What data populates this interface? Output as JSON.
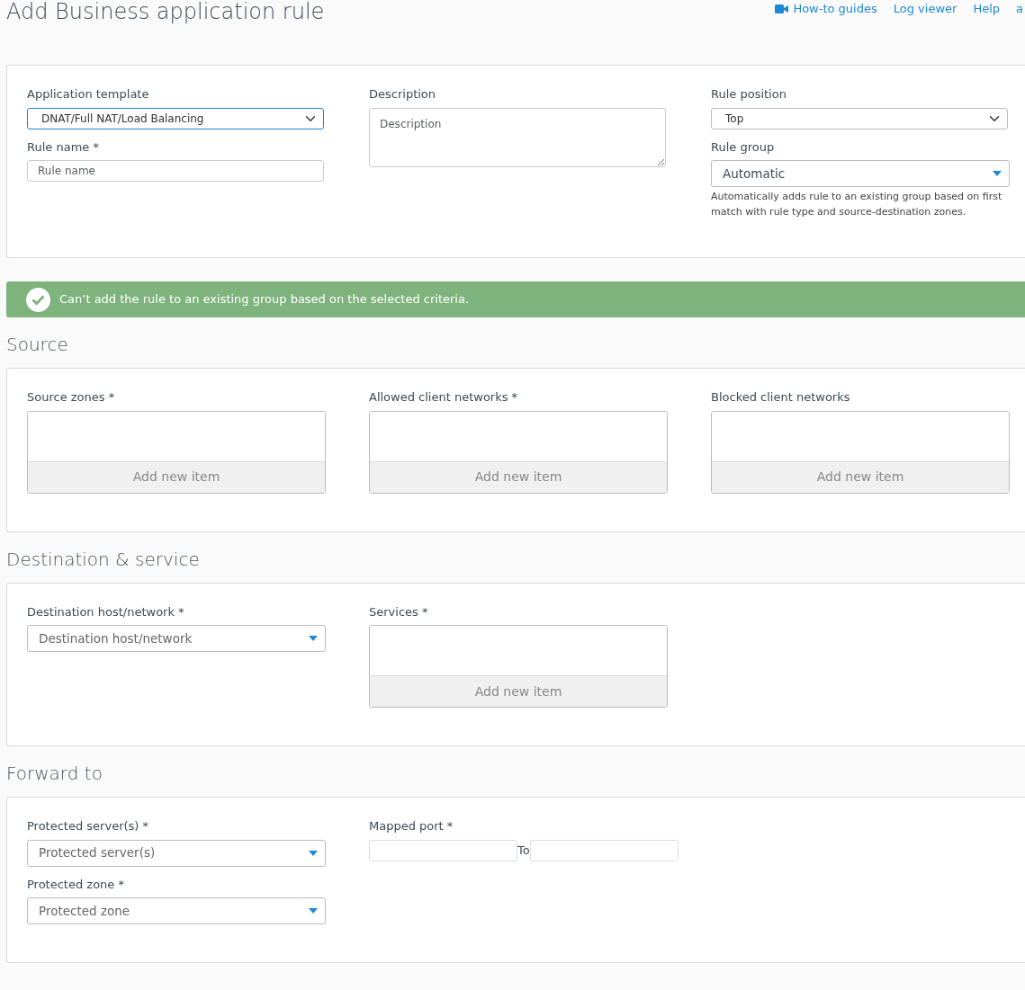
{
  "header": {
    "title": "Add Business application rule",
    "links": [
      {
        "label": "How-to guides",
        "kind": "video"
      },
      {
        "label": "Log viewer",
        "kind": "text"
      },
      {
        "label": "Help",
        "kind": "text"
      },
      {
        "label": "a",
        "kind": "text"
      }
    ]
  },
  "rule_card": {
    "columns": [
      [
        {
          "kind": "select",
          "label": "Application template",
          "value": "DNAT/Full NAT/Load Balancing",
          "focused": true
        },
        {
          "kind": "text",
          "label": "Rule name *",
          "placeholder": "Rule name"
        }
      ],
      [
        {
          "kind": "textarea",
          "label": "Description",
          "placeholder": "Description"
        }
      ],
      [
        {
          "kind": "select",
          "label": "Rule position",
          "value": "Top",
          "focused": false
        },
        {
          "kind": "combo",
          "label": "Rule group",
          "value": "Automatic",
          "help": "Automatically adds rule to an existing group based on first match with rule type and source-destination zones."
        }
      ]
    ]
  },
  "alert": {
    "text": "Can’t add the rule to an existing group based on the selected criteria."
  },
  "sections": [
    {
      "title": "Source",
      "columns": [
        [
          {
            "kind": "list",
            "label": "Source zones *",
            "button": "Add new item"
          }
        ],
        [
          {
            "kind": "list",
            "label": "Allowed client networks *",
            "button": "Add new item"
          }
        ],
        [
          {
            "kind": "list",
            "label": "Blocked client networks",
            "button": "Add new item"
          }
        ]
      ]
    },
    {
      "title": "Destination & service",
      "columns": [
        [
          {
            "kind": "combo",
            "label": "Destination host/network *",
            "placeholder": "Destination host/network"
          }
        ],
        [
          {
            "kind": "list",
            "label": "Services *",
            "button": "Add new item"
          }
        ]
      ]
    },
    {
      "title": "Forward to",
      "columns": [
        [
          {
            "kind": "combo",
            "label": "Protected server(s) *",
            "placeholder": "Protected server(s)"
          },
          {
            "kind": "combo",
            "label": "Protected zone *",
            "placeholder": "Protected zone"
          }
        ],
        [
          {
            "kind": "range",
            "label": "Mapped port *",
            "separator": "To"
          }
        ]
      ]
    }
  ]
}
